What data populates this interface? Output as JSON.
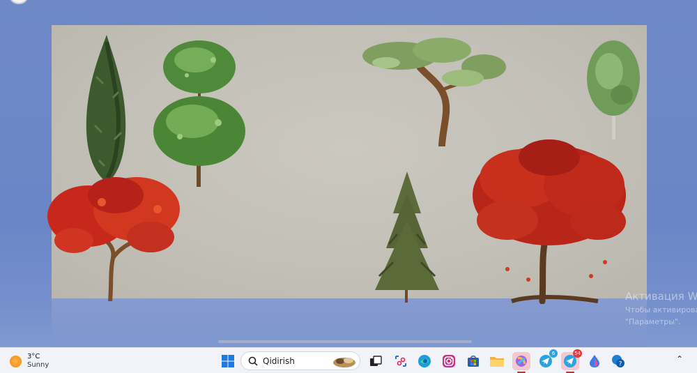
{
  "scene": {
    "trees": [
      {
        "name": "cypress-tree",
        "kind": "cypress"
      },
      {
        "name": "topiary-tree",
        "kind": "topiary"
      },
      {
        "name": "bonsai-pine-tree",
        "kind": "bonsai"
      },
      {
        "name": "birch-tree",
        "kind": "birch"
      },
      {
        "name": "red-maple-tree",
        "kind": "maple"
      },
      {
        "name": "spruce-tree",
        "kind": "spruce"
      },
      {
        "name": "red-oak-tree",
        "kind": "oak"
      }
    ],
    "colors": {
      "backdrop": "#c6c3bb",
      "background": "#6f89c7",
      "autumn_red": "#c8281b",
      "foliage_green": "#4f8a3a"
    }
  },
  "watermark": {
    "title": "Активация Wi",
    "line1": "Чтобы активироват",
    "line2": "\"Параметры\"."
  },
  "taskbar": {
    "weather": {
      "temperature": "3°C",
      "condition": "Sunny",
      "icon": "sun-icon"
    },
    "search": {
      "placeholder": "Qidirish",
      "icon": "search-icon"
    },
    "apps": [
      {
        "name": "start-button",
        "icon": "windows-logo-icon"
      },
      {
        "name": "task-view-button",
        "icon": "task-view-icon"
      },
      {
        "name": "snipping-tool-button",
        "icon": "snipping-tool-icon"
      },
      {
        "name": "edge-button",
        "icon": "edge-icon"
      },
      {
        "name": "instagram-button",
        "icon": "instagram-icon"
      },
      {
        "name": "store-button",
        "icon": "store-icon"
      },
      {
        "name": "file-explorer-button",
        "icon": "folder-icon"
      },
      {
        "name": "copilot-button",
        "icon": "copilot-icon"
      },
      {
        "name": "telegram-button",
        "icon": "telegram-icon",
        "badge": "6"
      },
      {
        "name": "telegram-2-button",
        "icon": "telegram-icon",
        "badge": "54"
      },
      {
        "name": "water-drop-app-button",
        "icon": "water-drop-icon"
      },
      {
        "name": "help-button",
        "icon": "help-icon"
      }
    ],
    "tray": {
      "chevron_icon": "chevron-up-icon"
    }
  }
}
